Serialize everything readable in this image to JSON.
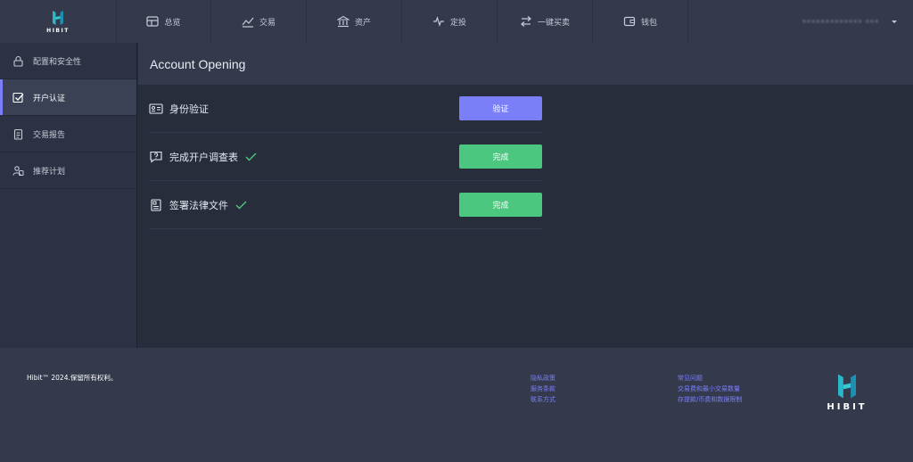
{
  "brand": {
    "name": "HIBIT"
  },
  "nav": {
    "items": [
      {
        "label": "总览",
        "icon": "dashboard-icon"
      },
      {
        "label": "交易",
        "icon": "trend-chart-icon"
      },
      {
        "label": "资产",
        "icon": "bank-icon"
      },
      {
        "label": "定投",
        "icon": "pulse-icon"
      },
      {
        "label": "一键买卖",
        "icon": "swap-arrows-icon"
      },
      {
        "label": "钱包",
        "icon": "wallet-icon"
      }
    ],
    "account_name": "••••••••••••• •••"
  },
  "sidebar": {
    "items": [
      {
        "label": "配置和安全性",
        "icon": "lock-icon",
        "active": false
      },
      {
        "label": "开户认证",
        "icon": "checkbox-icon",
        "active": true
      },
      {
        "label": "交易报告",
        "icon": "clipboard-icon",
        "active": false
      },
      {
        "label": "推荐计划",
        "icon": "users-icon",
        "active": false
      }
    ]
  },
  "main": {
    "title": "Account Opening",
    "rows": [
      {
        "label": "身份验证",
        "icon": "id-card-icon",
        "checked": false,
        "button": "验证"
      },
      {
        "label": "完成开户调查表",
        "icon": "question-bubble-icon",
        "checked": true,
        "button": "完成"
      },
      {
        "label": "签署法律文件",
        "icon": "document-icon",
        "checked": true,
        "button": "完成"
      }
    ]
  },
  "footer": {
    "copyright": "Hibit™ 2024.保留所有权利。",
    "links_col1": [
      "隐私政策",
      "服务条款",
      "联系方式"
    ],
    "links_col2": [
      "常见问题",
      "交易费和最小交易数量",
      "存提款/币费和数据限制"
    ],
    "logo_text": "HIBIT"
  },
  "colors": {
    "accent": "#7a7ef7",
    "success": "#4cc77f",
    "brand_teal": "#2ab7c9"
  }
}
